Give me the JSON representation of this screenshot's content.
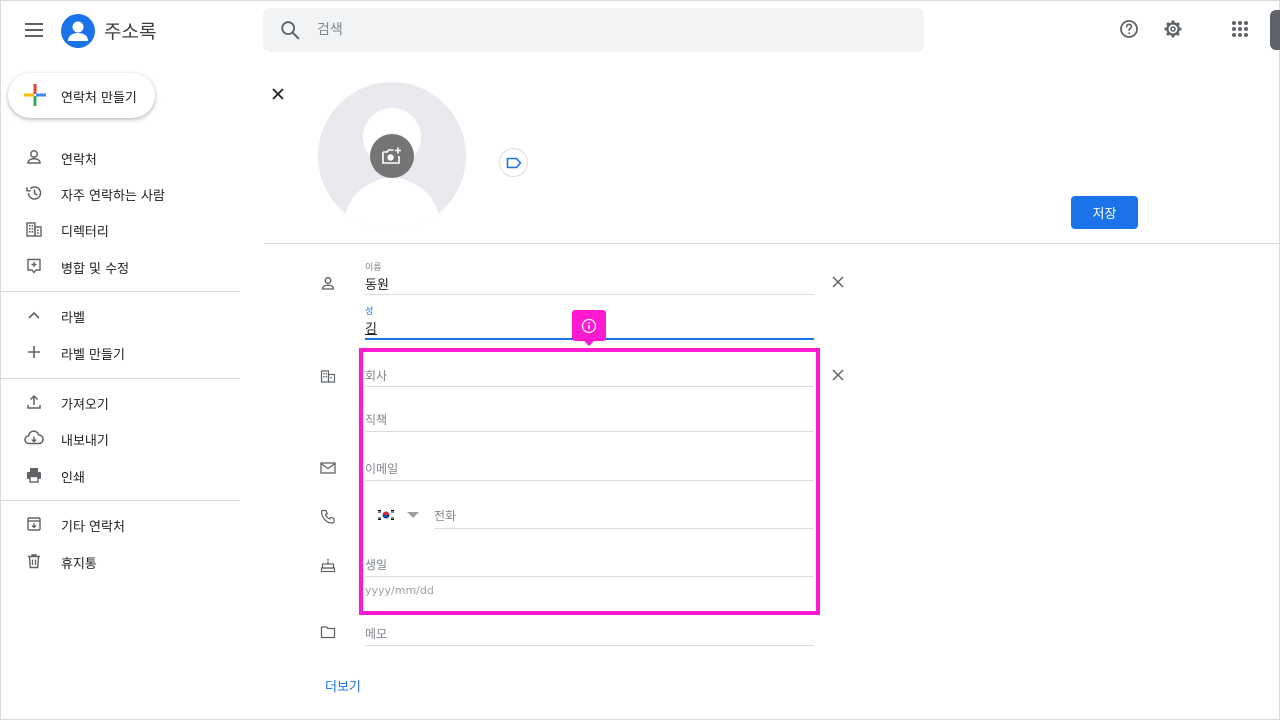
{
  "app": {
    "title": "주소록"
  },
  "search": {
    "placeholder": "검색"
  },
  "header_icons": [
    "menu-icon",
    "help-icon",
    "gear-icon",
    "apps-grid-icon"
  ],
  "sidebar": {
    "create_label": "연락처 만들기",
    "items": [
      {
        "label": "연락처",
        "icon": "person-icon"
      },
      {
        "label": "자주 연락하는 사람",
        "icon": "history-icon"
      },
      {
        "label": "디렉터리",
        "icon": "building-icon"
      },
      {
        "label": "병합 및 수정",
        "icon": "merge-icon"
      },
      {
        "label": "라벨",
        "icon": "chevron-up-icon"
      },
      {
        "label": "라벨 만들기",
        "icon": "plus-icon"
      },
      {
        "label": "가져오기",
        "icon": "upload-icon"
      },
      {
        "label": "내보내기",
        "icon": "cloud-download-icon"
      },
      {
        "label": "인쇄",
        "icon": "print-icon"
      },
      {
        "label": "기타 연락처",
        "icon": "archive-icon"
      },
      {
        "label": "휴지통",
        "icon": "trash-icon"
      }
    ]
  },
  "form": {
    "save_label": "저장",
    "first_name": {
      "label": "이름",
      "value": "동원"
    },
    "last_name": {
      "label": "성",
      "value": "김"
    },
    "company": {
      "placeholder": "회사"
    },
    "job_title": {
      "placeholder": "직책"
    },
    "email": {
      "placeholder": "이메일"
    },
    "phone": {
      "placeholder": "전화",
      "country": "KR"
    },
    "birthday": {
      "placeholder": "생일",
      "format_placeholder": "yyyy/mm/dd"
    },
    "notes": {
      "placeholder": "메모"
    },
    "more_label": "더보기"
  },
  "colors": {
    "accent": "#1a73e8",
    "highlight": "#ff1ad2"
  }
}
